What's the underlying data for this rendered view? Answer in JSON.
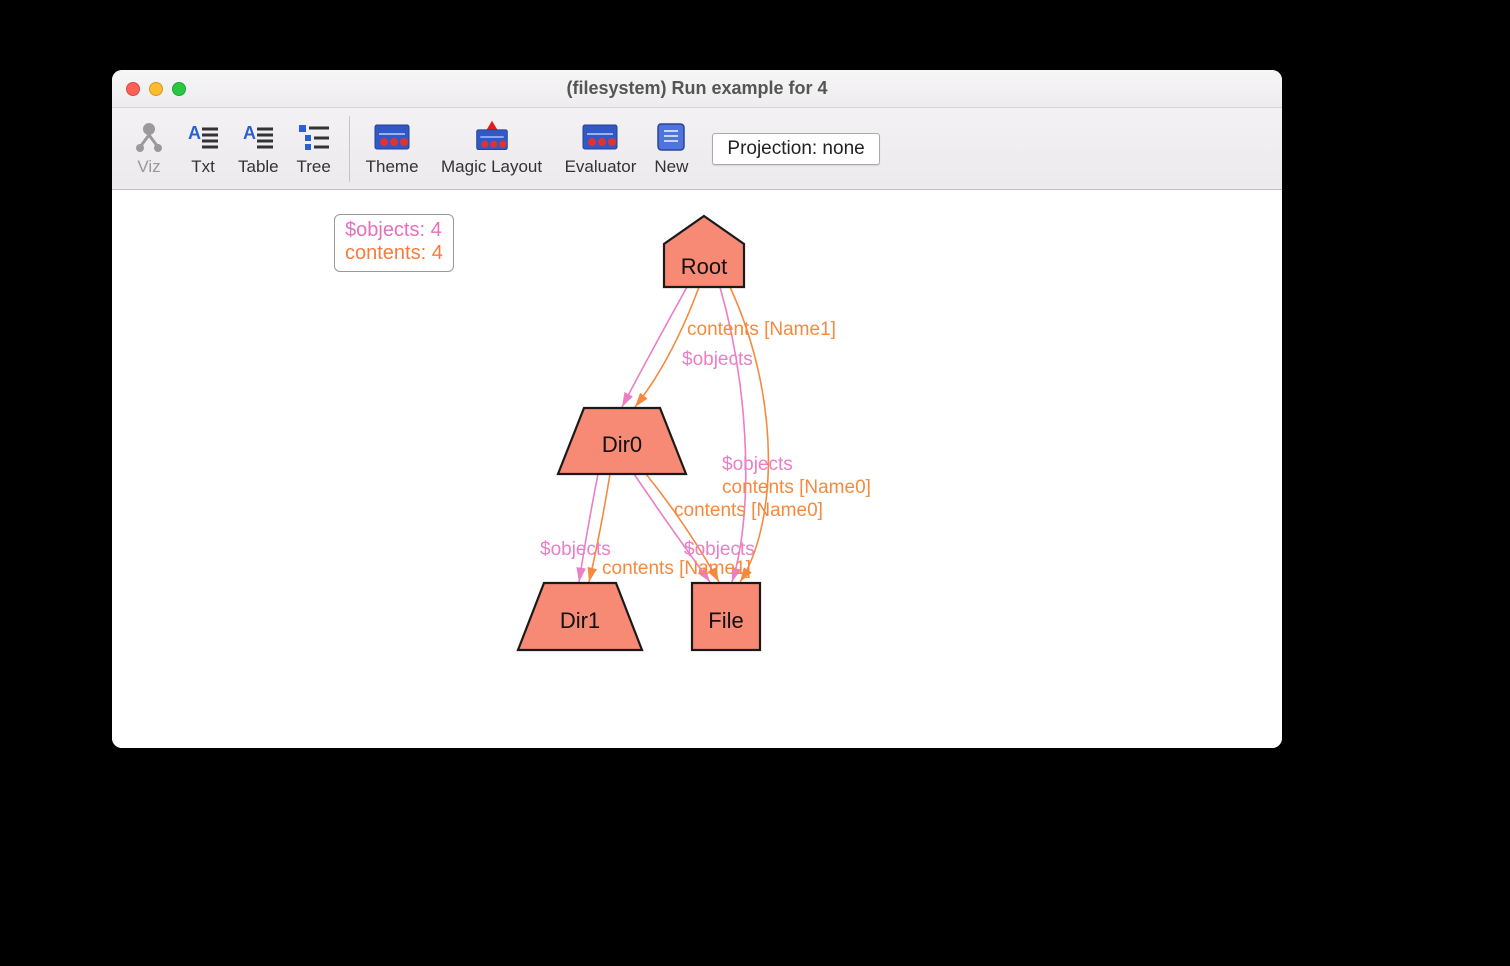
{
  "window": {
    "title": "(filesystem) Run example for 4"
  },
  "toolbar": {
    "items": [
      {
        "label": "Viz",
        "icon": "viz"
      },
      {
        "label": "Txt",
        "icon": "txt"
      },
      {
        "label": "Table",
        "icon": "txt"
      },
      {
        "label": "Tree",
        "icon": "tree"
      }
    ],
    "items2": [
      {
        "label": "Theme",
        "icon": "slider"
      },
      {
        "label": "Magic Layout",
        "icon": "slider-arrow"
      },
      {
        "label": "Evaluator",
        "icon": "slider"
      },
      {
        "label": "New",
        "icon": "scroll"
      }
    ],
    "projection": "Projection: none"
  },
  "legend": {
    "line1": "$objects: 4",
    "line2": "contents: 4"
  },
  "graph": {
    "nodes": {
      "root": "Root",
      "dir0": "Dir0",
      "dir1": "Dir1",
      "file": "File"
    },
    "edge_labels": {
      "root_dir0_contents": "contents [Name1]",
      "root_dir0_objects": "$objects",
      "root_file_objects": "$objects",
      "root_file_contents": "contents [Name0]",
      "dir0_file_contents": "contents [Name0]",
      "dir0_dir1_objects": "$objects",
      "dir0_file_objects": "$objects",
      "dir0_dir1_contents": "contents [Name1]"
    }
  }
}
